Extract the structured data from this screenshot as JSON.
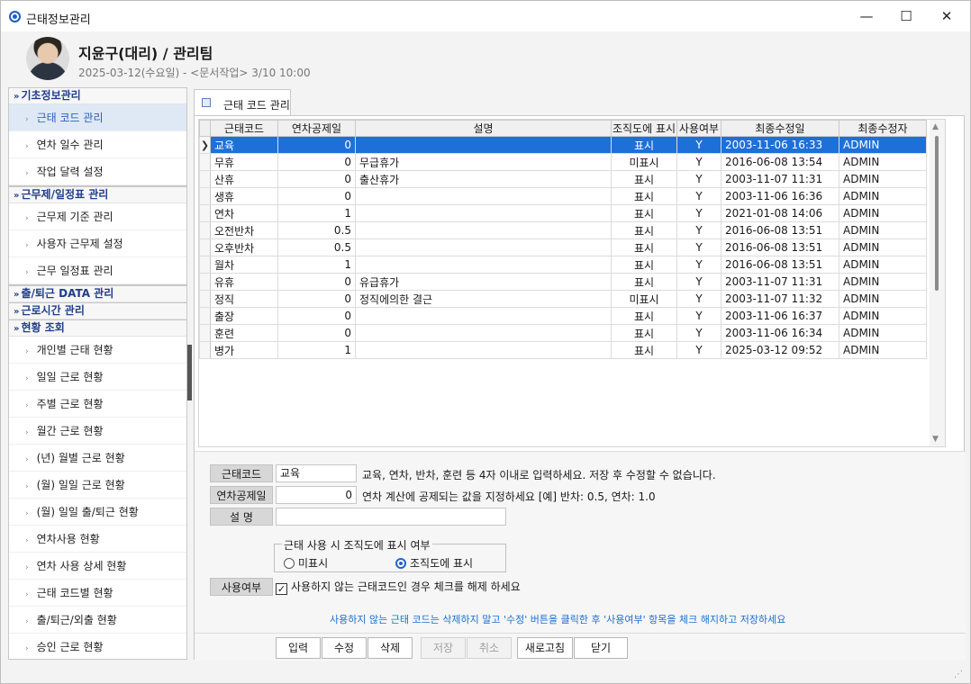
{
  "window": {
    "title": "근태정보관리",
    "minimize": "—",
    "maximize": "☐",
    "close": "✕"
  },
  "header": {
    "name": "지윤구(대리) / 관리팀",
    "date_line": "2025-03-12(수요일) - <문서작업> 3/10 10:00"
  },
  "sidebar": {
    "groups": [
      {
        "title": "기초정보관리",
        "expanded": true,
        "items": [
          "근태 코드 관리",
          "연차 일수 관리",
          "작업 달력 설정"
        ]
      },
      {
        "title": "근무제/일정표 관리",
        "expanded": true,
        "items": [
          "근무제 기준 관리",
          "사용자 근무제 설정",
          "근무 일정표 관리"
        ]
      },
      {
        "title": "출/퇴근 DATA 관리",
        "expanded": false,
        "items": []
      },
      {
        "title": "근로시간 관리",
        "expanded": false,
        "items": []
      },
      {
        "title": "현황 조회",
        "expanded": true,
        "items": [
          "개인별 근태 현황",
          "일일 근로 현황",
          "주별 근로 현황",
          "월간 근로 현황",
          "(년) 월별 근로 현황",
          "(월) 일일 근로 현황",
          "(월) 일일 출/퇴근 현황",
          "연차사용 현황",
          "연차 사용 상세 현황",
          "근태 코드별 현황",
          "출/퇴근/외출 현황",
          "승인 근로 현황"
        ]
      }
    ],
    "active_item": "근태 코드 관리"
  },
  "tab": {
    "label": "근태 코드 관리"
  },
  "grid": {
    "columns": [
      "근태코드",
      "연차공제일",
      "설명",
      "조직도에 표시",
      "사용여부",
      "최종수정일",
      "최종수정자"
    ],
    "selected_row": 0,
    "rows": [
      [
        "교육",
        "0",
        "",
        "표시",
        "Y",
        "2003-11-06 16:33",
        "ADMIN"
      ],
      [
        "무휴",
        "0",
        "무급휴가",
        "미표시",
        "Y",
        "2016-06-08 13:54",
        "ADMIN"
      ],
      [
        "산휴",
        "0",
        "출산휴가",
        "표시",
        "Y",
        "2003-11-07 11:31",
        "ADMIN"
      ],
      [
        "생휴",
        "0",
        "",
        "표시",
        "Y",
        "2003-11-06 16:36",
        "ADMIN"
      ],
      [
        "연차",
        "1",
        "",
        "표시",
        "Y",
        "2021-01-08 14:06",
        "ADMIN"
      ],
      [
        "오전반차",
        "0.5",
        "",
        "표시",
        "Y",
        "2016-06-08 13:51",
        "ADMIN"
      ],
      [
        "오후반차",
        "0.5",
        "",
        "표시",
        "Y",
        "2016-06-08 13:51",
        "ADMIN"
      ],
      [
        "월차",
        "1",
        "",
        "표시",
        "Y",
        "2016-06-08 13:51",
        "ADMIN"
      ],
      [
        "유휴",
        "0",
        "유급휴가",
        "표시",
        "Y",
        "2003-11-07 11:31",
        "ADMIN"
      ],
      [
        "정직",
        "0",
        "정직에의한 결근",
        "미표시",
        "Y",
        "2003-11-07 11:32",
        "ADMIN"
      ],
      [
        "출장",
        "0",
        "",
        "표시",
        "Y",
        "2003-11-06 16:37",
        "ADMIN"
      ],
      [
        "훈련",
        "0",
        "",
        "표시",
        "Y",
        "2003-11-06 16:34",
        "ADMIN"
      ],
      [
        "병가",
        "1",
        "",
        "표시",
        "Y",
        "2025-03-12 09:52",
        "ADMIN"
      ]
    ]
  },
  "form": {
    "code_label": "근태코드",
    "code_value": "교육",
    "code_hint": "교육, 연차, 반차, 훈련 등 4자 이내로 입력하세요. 저장 후 수정할 수 없습니다.",
    "deduct_label": "연차공제일",
    "deduct_value": "0",
    "deduct_hint": "연차 계산에 공제되는 값을 지정하세요 [예] 반차: 0.5,  연차: 1.0",
    "desc_label": "설  명",
    "desc_value": "",
    "display_group_title": "근태 사용 시 조직도에 표시 여부",
    "radio_hide": "미표시",
    "radio_show": "조직도에 표시",
    "radio_selected": "show",
    "use_label": "사용여부",
    "use_check_text": "사용하지 않는 근태코드인 경우 체크를 해제 하세요",
    "use_checked": true,
    "notice": "사용하지 않는 근태 코드는 삭제하지 말고 '수정' 버튼을 클릭한 후  '사용여부' 항목을  체크 해지하고 저장하세요"
  },
  "buttons": {
    "insert": "입력",
    "edit": "수정",
    "delete": "삭제",
    "save": "저장",
    "cancel": "취소",
    "refresh": "새로고침",
    "close": "닫기"
  },
  "icons": {
    "window": "app-circle-icon",
    "tab": "tab-doc-icon",
    "expanded": "chevron-double-down-icon",
    "collapsed": "chevron-double-right-icon"
  },
  "colors": {
    "accent": "#1e70d8",
    "sidebar_active_bg": "#dfe8f5",
    "group_title": "#1f3d8a",
    "notice": "#1a6fd0"
  }
}
